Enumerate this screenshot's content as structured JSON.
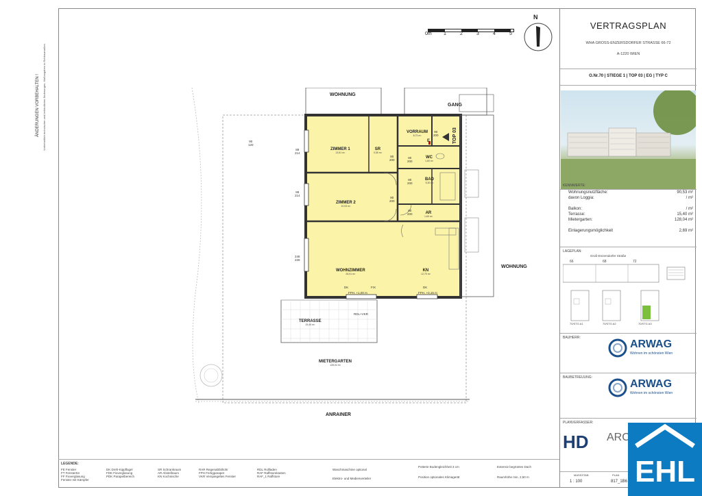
{
  "title_block": {
    "title": "VERTRAGSPLAN",
    "address_line1": "WHA GROSS-ENZERSDORFER STRASSE 66-72",
    "address_line2": "A-1220 WIEN",
    "unit_strip": "O.Nr.70 | STIEGE 1 | TOP 03 | EG | TYP C",
    "kennwerte_label": "KENNWERTE:",
    "kennwerte": [
      {
        "label": "Wohnungsnutzfläche:",
        "value": "90,53 m²"
      },
      {
        "label": "davon Loggia:",
        "value": "/ m²"
      },
      {
        "label": "Balkon:",
        "value": "/ m²"
      },
      {
        "label": "Terrasse:",
        "value": "15,40 m²"
      },
      {
        "label": "Mietergarten:",
        "value": "128,04 m²"
      },
      {
        "label": "Einlagerungsmöglichkeit",
        "value": "2,69 m²"
      }
    ],
    "lageplan_label": "LAGEPLAN:",
    "lageplan_street": "Groß-Enzersdorfer Straße",
    "lageplan_numbers": [
      "66",
      "68",
      "72"
    ],
    "lageplan_stiegen": [
      "70/STG A1",
      "70/STG A2",
      "70/STG A3"
    ],
    "bauherr_label": "BAUHERR:",
    "bauherr_name": "ARWAG",
    "bauherr_tagline": "Wohnen im schönsten Wien",
    "baubetreuung_label": "BAUBETREUUNG:",
    "baubetreuung_name": "ARWAG",
    "baubetreuung_tagline": "Wohnen im schönsten Wien",
    "planverfasser_label": "PLANVERFASSER:",
    "planverfasser_logo": "HD",
    "planverfasser_text": "ARC",
    "scale_label": "MASSSTAB",
    "scale_value": "1 : 100",
    "plan_no_label": "PLAN",
    "plan_no": "817_1B6"
  },
  "north": {
    "label": "N"
  },
  "scale_bar": {
    "labels": [
      "0m",
      "1",
      "2",
      "3",
      "4",
      "5"
    ]
  },
  "plan": {
    "neighbors": {
      "top": "WOHNUNG",
      "right": "WOHNUNG",
      "bottom": "ANRAINER",
      "gang": "GANG",
      "top_label": "TOP 03"
    },
    "rooms": [
      {
        "name": "ZIMMER 1",
        "area": "13,51 m²"
      },
      {
        "name": "SR",
        "area": "0,55 m²"
      },
      {
        "name": "VORRAUM",
        "area": "8,73 m²"
      },
      {
        "name": "WC",
        "area": "1,60 m²"
      },
      {
        "name": "BAD",
        "area": "5,30 m²"
      },
      {
        "name": "ZIMMER 2",
        "area": "10,93 m²"
      },
      {
        "name": "AR",
        "area": "1,69 m²"
      },
      {
        "name": "WOHNZIMMER",
        "area": "26,91 m²"
      },
      {
        "name": "KN",
        "area": "12,75 m²"
      },
      {
        "name": "TERRASSE",
        "area": "15,40 m²"
      },
      {
        "name": "MIETERGARTEN",
        "area": "128,04 m²"
      }
    ],
    "doors": [
      {
        "a": "80",
        "b": "200"
      },
      {
        "a": "80",
        "b": "200"
      },
      {
        "a": "80",
        "b": "200"
      },
      {
        "a": "80",
        "b": "200"
      },
      {
        "a": "90",
        "b": "200"
      },
      {
        "a": "80",
        "b": "200"
      }
    ],
    "windows": [
      {
        "a": "88",
        "b": "214"
      },
      {
        "a": "88",
        "b": "214"
      },
      {
        "a": "248",
        "b": "228"
      },
      {
        "a": "90",
        "b": "120"
      }
    ],
    "door_marks": [
      "DK",
      "FIX",
      "DK"
    ],
    "sill_notes": [
      "FPH. +1,00 m",
      "FPH. +0,15 m"
    ],
    "terrace_note": "RDL+VKR",
    "other_labels": [
      "E"
    ]
  },
  "legend": {
    "title": "LEGENDE:",
    "col1": [
      "FE  Fenster",
      "FT  Fenstertür",
      "FF  Fixverglasung",
      "    Fenster mit Kämpfer"
    ],
    "col2": [
      "DK  Dreh-Kippflügel",
      "FDK  Fixverglasung",
      "PDK  Parapetbereich"
    ],
    "col3": [
      "SR  Schrankraum",
      "AR  Abstellraum",
      "KN  Kochnische"
    ],
    "col4": [
      "RAR  Regenabfallrohr",
      "FPH  Fertigparapet",
      "VKR  Verspiegeltes Fenster"
    ],
    "col5": [
      "RDL  Rollladen",
      "RAF  Raffstorekasten",
      "RAF_1  Raffstore"
    ],
    "col6": [
      "Waschmaschine optional",
      "Elektro- und Medienverteiler"
    ],
    "col7": [
      "Potterie Bodengleichheit 3 cm",
      "Position optionales Klimagerät"
    ],
    "col8": [
      "Extensiv begrüntes Dach",
      "Raumhöhe min. 2,50 m"
    ]
  },
  "side_note": {
    "title": "ÄNDERUNGEN VORBEHALTEN !",
    "text": "Vorbehaltlich technischer und behördlicher Änderungen. Maßangaben in Rohbaumaßen."
  },
  "colors": {
    "room_fill": "#fbf3a8",
    "wall": "#333333",
    "ehl_blue": "#0c7bc2",
    "arwag_blue": "#1a4f8b"
  }
}
